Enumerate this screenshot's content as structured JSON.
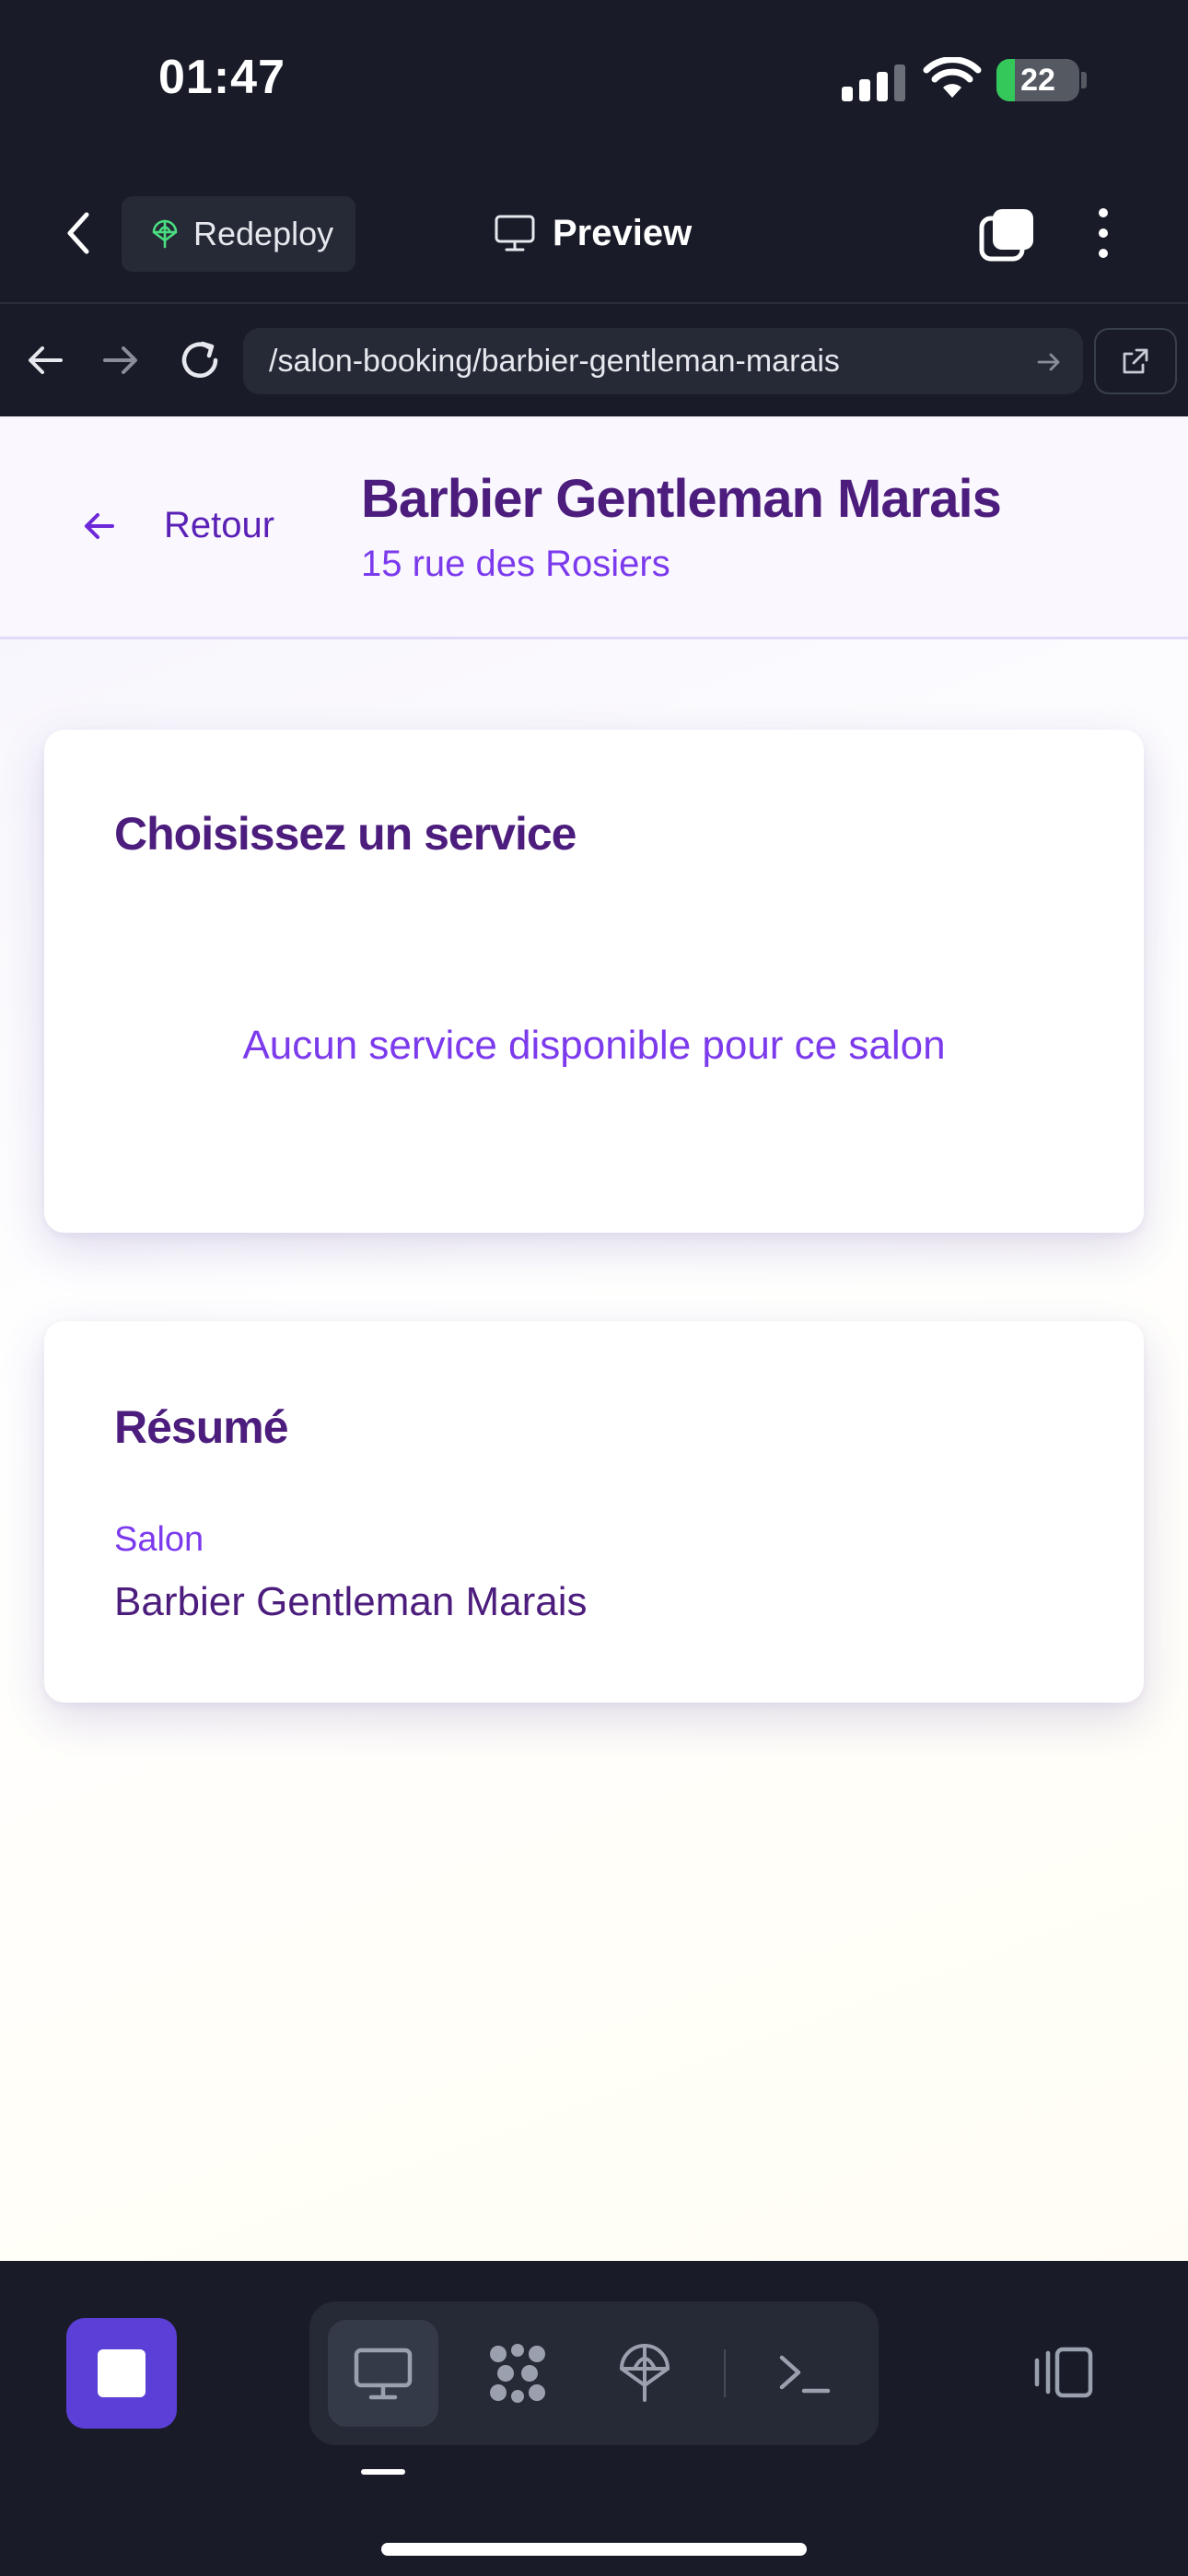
{
  "status_bar": {
    "time": "01:47",
    "battery": "22",
    "battery_level": 0.22
  },
  "toolbar": {
    "redeploy_label": "Redeploy",
    "preview_label": "Preview"
  },
  "url_bar": {
    "url": "/salon-booking/barbier-gentleman-marais"
  },
  "page": {
    "back_label": "Retour",
    "salon_name": "Barbier Gentleman Marais",
    "salon_address": "15 rue des Rosiers",
    "services_card": {
      "title": "Choisissez un service",
      "empty_message": "Aucun service disponible pour ce salon"
    },
    "summary_card": {
      "title": "Résumé",
      "salon_label": "Salon",
      "salon_value": "Barbier Gentleman Marais"
    }
  },
  "dock": {
    "tools": [
      "monitor-icon",
      "sparkles-icon",
      "globe-icon",
      "terminal-icon"
    ],
    "active_tool": "monitor-icon"
  },
  "colors": {
    "accent": "#7c3aed",
    "heading": "#4c1d7d",
    "stop_button": "#5b3fd6",
    "chrome_bg": "#191c28"
  }
}
